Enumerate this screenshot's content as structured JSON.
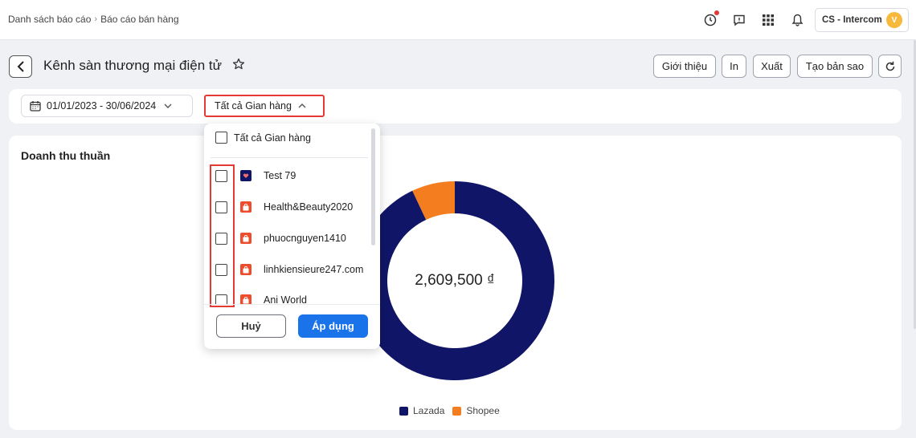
{
  "breadcrumb": {
    "root": "Danh sách báo cáo",
    "current": "Báo cáo bán hàng"
  },
  "header": {
    "account": "CS - Intercom",
    "avatar_letter": "V",
    "icons": [
      "history-icon",
      "feedback-icon",
      "apps-grid-icon",
      "bell-icon"
    ]
  },
  "title_row": {
    "title": "Kênh sàn thương mại điện tử",
    "buttons": {
      "intro": "Giới thiệu",
      "print": "In",
      "export": "Xuất",
      "copy": "Tạo bản sao"
    }
  },
  "filters": {
    "date_range": "01/01/2023 - 30/06/2024",
    "store_select": "Tất cả Gian hàng"
  },
  "card": {
    "title": "Doanh thu thuần",
    "total": "2,609,500 ₫"
  },
  "dropdown": {
    "select_all_label": "Tất cả Gian hàng",
    "items": [
      {
        "label": "Test 79",
        "icon": "lazada-shop-icon"
      },
      {
        "label": "Health&Beauty2020",
        "icon": "shopee-shop-icon"
      },
      {
        "label": "phuocnguyen1410",
        "icon": "shopee-shop-icon"
      },
      {
        "label": "linhkiensieure247.com",
        "icon": "shopee-shop-icon"
      },
      {
        "label": "Ani World",
        "icon": "shopee-shop-icon"
      }
    ],
    "cancel_label": "Huỷ",
    "apply_label": "Áp dụng"
  },
  "colors": {
    "lazada": "#101567",
    "shopee": "#f47d20",
    "primary": "#1a73e8",
    "highlight": "#e53935"
  },
  "chart_data": {
    "type": "pie",
    "categories": [
      "Lazada",
      "Shopee"
    ],
    "values": [
      93,
      7
    ],
    "center_label": "2,609,500 ₫",
    "legend_position": "bottom"
  }
}
